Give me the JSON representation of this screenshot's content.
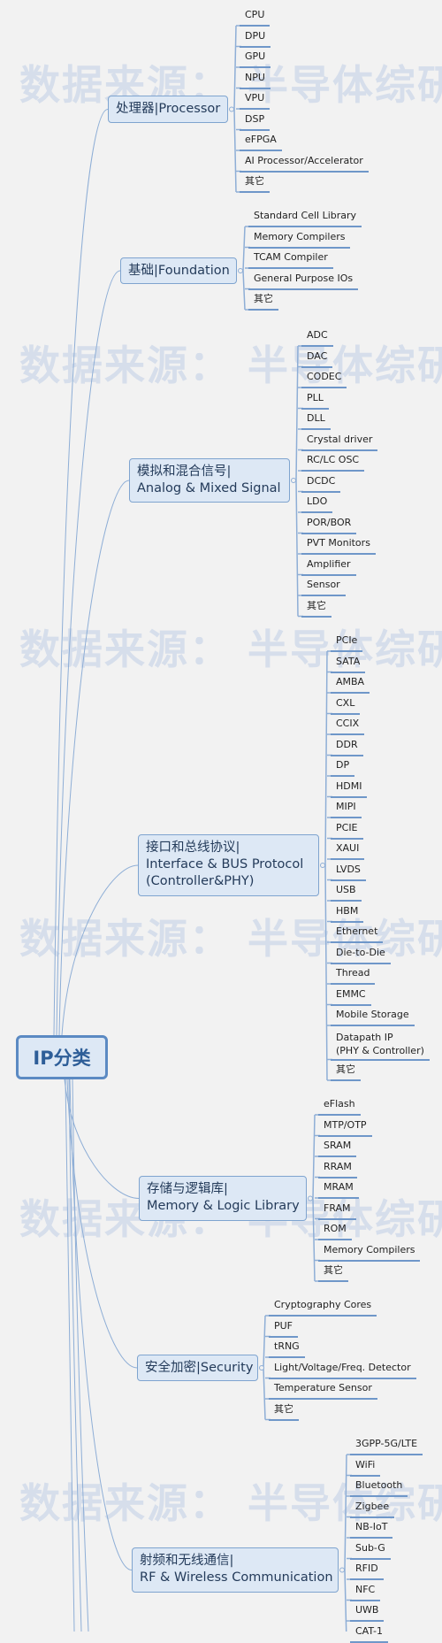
{
  "watermark": "数据来源：  半导体综研",
  "root": {
    "label": "IP分类"
  },
  "colors": {
    "background": "#f2f2f2",
    "node_fill": "#dde8f5",
    "node_border": "#7fa4cf",
    "connector": "#8eaed6",
    "leaf_underline": "#6f97c9",
    "watermark": "#d6deeb"
  },
  "branches": [
    {
      "label": "处理器|Processor",
      "lines": [
        "处理器|Processor"
      ],
      "children": [
        "CPU",
        "DPU",
        "GPU",
        "NPU",
        "VPU",
        "DSP",
        "eFPGA",
        "AI Processor/Accelerator",
        "其它"
      ]
    },
    {
      "label": "基础|Foundation",
      "lines": [
        "基础|Foundation"
      ],
      "children": [
        "Standard Cell Library",
        "Memory Compilers",
        "TCAM Compiler",
        "General Purpose IOs",
        "其它"
      ]
    },
    {
      "label": "模拟和混合信号| Analog & Mixed Signal",
      "lines": [
        "模拟和混合信号|",
        "Analog & Mixed Signal"
      ],
      "children": [
        "ADC",
        "DAC",
        "CODEC",
        "PLL",
        "DLL",
        "Crystal driver",
        "RC/LC OSC",
        "DCDC",
        "LDO",
        "POR/BOR",
        "PVT Monitors",
        "Amplifier",
        "Sensor",
        "其它"
      ]
    },
    {
      "label": "接口和总线协议| Interface & BUS Protocol (Controller&PHY)",
      "lines": [
        "接口和总线协议|",
        "Interface & BUS Protocol",
        "(Controller&PHY)"
      ],
      "children": [
        "PCIe",
        "SATA",
        "AMBA",
        "CXL",
        "CCIX",
        "DDR",
        "DP",
        "HDMI",
        "MIPI",
        "PCIE",
        "XAUI",
        "LVDS",
        "USB",
        "HBM",
        "Ethernet",
        " Die-to-Die",
        "Thread",
        "EMMC",
        "Mobile Storage",
        "Datapath IP\n(PHY & Controller)",
        "其它"
      ]
    },
    {
      "label": "存储与逻辑库| Memory & Logic Library",
      "lines": [
        "存储与逻辑库|",
        "Memory & Logic Library"
      ],
      "children": [
        "eFlash",
        "MTP/OTP",
        "SRAM",
        "RRAM",
        "MRAM",
        "FRAM",
        "ROM",
        "Memory Compilers",
        "其它"
      ]
    },
    {
      "label": "安全加密|Security",
      "lines": [
        "安全加密|Security"
      ],
      "children": [
        "Cryptography Cores",
        "PUF",
        "tRNG",
        "Light/Voltage/Freq. Detector",
        "Temperature Sensor",
        "其它"
      ]
    },
    {
      "label": "射频和无线通信| RF & Wireless Communication",
      "lines": [
        "射频和无线通信|",
        "RF & Wireless Communication"
      ],
      "children": [
        "3GPP-5G/LTE",
        "WiFi",
        "Bluetooth",
        "Zigbee",
        "NB-IoT",
        "Sub-G",
        "RFID",
        "NFC",
        "UWB",
        "CAT-1"
      ]
    }
  ]
}
